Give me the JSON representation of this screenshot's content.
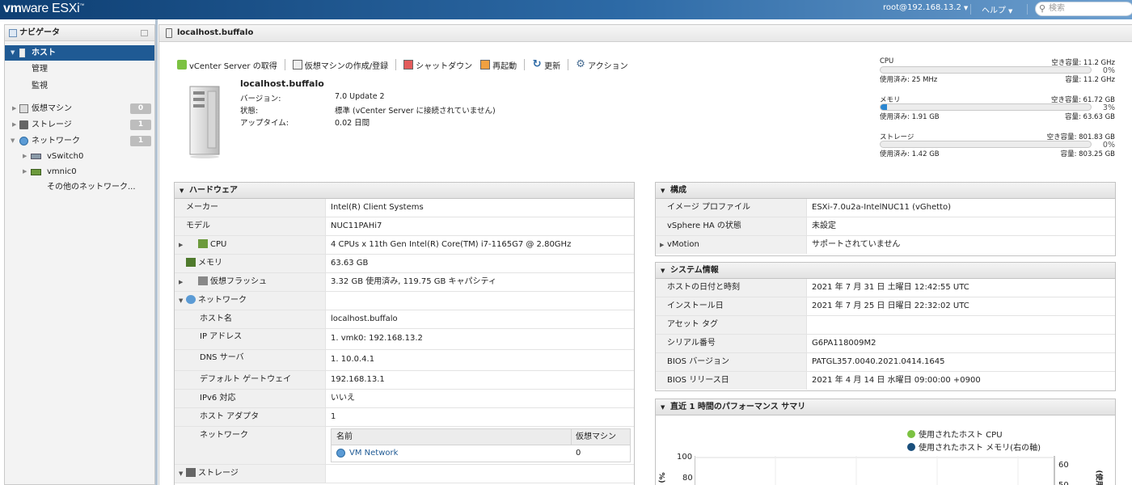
{
  "app": {
    "brand": "vm",
    "brand_rest": "ware",
    "product": "ESXi",
    "tm": "™"
  },
  "topbar": {
    "user": "root@192.168.13.2",
    "help": "ヘルプ",
    "search_placeholder": "検索"
  },
  "navigator": {
    "title": "ナビゲータ",
    "items": [
      {
        "label": "ホスト"
      },
      {
        "label": "管理"
      },
      {
        "label": "監視"
      },
      {
        "label": "仮想マシン",
        "count": "0"
      },
      {
        "label": "ストレージ",
        "count": "1"
      },
      {
        "label": "ネットワーク",
        "count": "1"
      },
      {
        "label": "vSwitch0"
      },
      {
        "label": "vmnic0"
      },
      {
        "label": "その他のネットワーク..."
      }
    ]
  },
  "main": {
    "title": "localhost.buffalo",
    "actions": [
      "vCenter Server の取得",
      "仮想マシンの作成/登録",
      "シャットダウン",
      "再起動",
      "更新",
      "アクション"
    ],
    "host": {
      "name": "localhost.buffalo",
      "fields": [
        {
          "k": "バージョン:",
          "v": "7.0 Update 2"
        },
        {
          "k": "状態:",
          "v": "標準 (vCenter Server に接続されていません)"
        },
        {
          "k": "アップタイム:",
          "v": "0.02 日間"
        }
      ]
    },
    "resources": [
      {
        "name": "CPU",
        "free": "空き容量: 11.2 GHz",
        "pct": "0%",
        "fill": 0,
        "used": "使用済み: 25 MHz",
        "cap": "容量: 11.2 GHz"
      },
      {
        "name": "メモリ",
        "free": "空き容量: 61.72 GB",
        "pct": "3%",
        "fill": 0.03,
        "used": "使用済み: 1.91 GB",
        "cap": "容量: 63.63 GB"
      },
      {
        "name": "ストレージ",
        "free": "空き容量: 801.83 GB",
        "pct": "0%",
        "fill": 0,
        "used": "使用済み: 1.42 GB",
        "cap": "容量: 803.25 GB"
      }
    ]
  },
  "hardware": {
    "title": "ハードウェア",
    "rows": [
      {
        "k": "メーカー",
        "v": "Intel(R) Client Systems"
      },
      {
        "k": "モデル",
        "v": "NUC11PAHi7"
      },
      {
        "k": "CPU",
        "v": "4 CPUs x 11th Gen Intel(R) Core(TM) i7-1165G7 @ 2.80GHz"
      },
      {
        "k": "メモリ",
        "v": "63.63 GB"
      },
      {
        "k": "仮想フラッシュ",
        "v": "3.32 GB 使用済み, 119.75 GB キャパシティ"
      },
      {
        "k": "ネットワーク",
        "v": ""
      },
      {
        "k": "ホスト名",
        "v": "localhost.buffalo"
      },
      {
        "k": "IP アドレス",
        "v": "1. vmk0: 192.168.13.2"
      },
      {
        "k": "DNS サーバ",
        "v": "1. 10.0.4.1"
      },
      {
        "k": "デフォルト ゲートウェイ",
        "v": "192.168.13.1"
      },
      {
        "k": "IPv6 対応",
        "v": "いいえ"
      },
      {
        "k": "ホスト アダプタ",
        "v": "1"
      },
      {
        "k": "ネットワーク",
        "v": ""
      },
      {
        "k": "ストレージ",
        "v": ""
      }
    ],
    "net_table": {
      "col_name": "名前",
      "col_vms": "仮想マシン",
      "row_name": "VM Network",
      "row_vms": "0"
    }
  },
  "config": {
    "title": "構成",
    "rows": [
      {
        "k": "イメージ プロファイル",
        "v": "ESXi-7.0u2a-IntelNUC11 (vGhetto)"
      },
      {
        "k": "vSphere HA の状態",
        "v": "未設定"
      },
      {
        "k": "vMotion",
        "v": "サポートされていません"
      }
    ]
  },
  "sysinfo": {
    "title": "システム情報",
    "rows": [
      {
        "k": "ホストの日付と時刻",
        "v": "2021 年 7 月 31 日 土曜日 12:42:55 UTC"
      },
      {
        "k": "インストール日",
        "v": "2021 年 7 月 25 日 日曜日 22:32:02 UTC"
      },
      {
        "k": "アセット タグ",
        "v": ""
      },
      {
        "k": "シリアル番号",
        "v": "G6PA118009M2"
      },
      {
        "k": "BIOS バージョン",
        "v": "PATGL357.0040.2021.0414.1645"
      },
      {
        "k": "BIOS リリース日",
        "v": "2021 年 4 月 14 日 水曜日 09:00:00 +0900"
      }
    ]
  },
  "perf": {
    "title": "直近 1 時間のパフォーマンス サマリ",
    "legend_cpu": "使用されたホスト CPU",
    "legend_mem": "使用されたホスト メモリ(右の軸)",
    "y_left_top": "100",
    "y_left_next": "80",
    "y_right_top": "60",
    "y_right_next": "50",
    "y_left_label": "%)",
    "y_right_label": "(使用",
    "colors": {
      "cpu": "#7cc242",
      "mem": "#1a4f7c"
    }
  }
}
